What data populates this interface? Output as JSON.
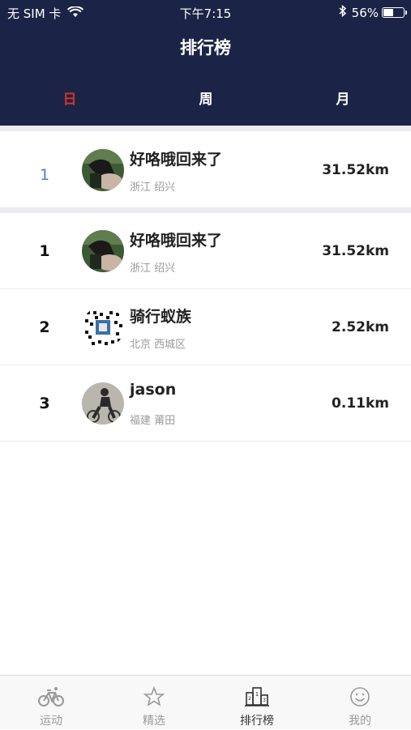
{
  "status_bar": {
    "carrier": "无 SIM 卡",
    "time": "下午7:15",
    "battery_percent": "56%",
    "battery_level": 0.56
  },
  "header": {
    "title": "排行榜",
    "tabs": [
      {
        "label": "日",
        "active": true
      },
      {
        "label": "周",
        "active": false
      },
      {
        "label": "月",
        "active": false
      }
    ]
  },
  "my_rank": {
    "rank": "1",
    "name": "好咯哦回来了",
    "location": "浙江 绍兴",
    "distance": "31.52km"
  },
  "ranking": [
    {
      "rank": "1",
      "name": "好咯哦回来了",
      "location": "浙江 绍兴",
      "distance": "31.52km",
      "avatar": "dark-photo-avatar"
    },
    {
      "rank": "2",
      "name": "骑行蚁族",
      "location": "北京 西城区",
      "distance": "2.52km",
      "avatar": "qr-code-avatar"
    },
    {
      "rank": "3",
      "name": "jason",
      "location": "福建 莆田",
      "distance": "0.11km",
      "avatar": "cyclist-photo-avatar"
    }
  ],
  "tabbar": {
    "items": [
      {
        "label": "运动",
        "icon": "bicycle-icon",
        "active": false
      },
      {
        "label": "精选",
        "icon": "star-icon",
        "active": false
      },
      {
        "label": "排行榜",
        "icon": "podium-icon",
        "active": true
      },
      {
        "label": "我的",
        "icon": "smiley-icon",
        "active": false
      }
    ]
  },
  "colors": {
    "header_bg": "#1b2446",
    "active_tab": "#d0342c",
    "my_rank": "#4a7fd4"
  }
}
